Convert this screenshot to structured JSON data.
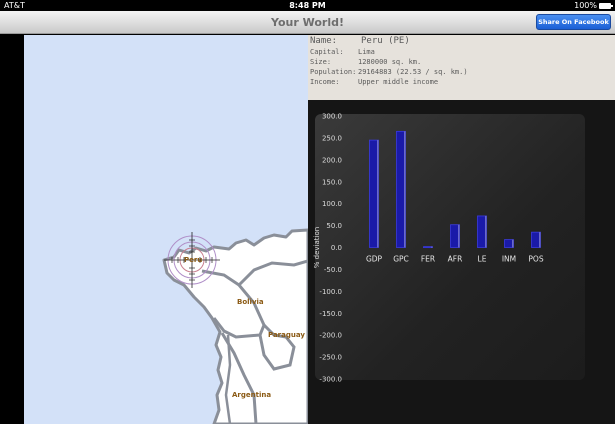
{
  "status_bar": {
    "carrier": "AT&T",
    "time": "8:48 PM",
    "battery": "100%"
  },
  "nav": {
    "title": "Your World!",
    "share_button": "Share On Facebook"
  },
  "map": {
    "labels": {
      "peru": "Peru",
      "bolivia": "Bolivia",
      "paraguay": "Paraguay",
      "argentina": "Argentina"
    }
  },
  "country": {
    "name_key": "Name:",
    "name": "Peru (PE)",
    "capital_key": "Capital:",
    "capital": "Lima",
    "size_key": "Size:",
    "size": "1280000 sq. km.",
    "population_key": "Population:",
    "population": "29164883 (22.53 / sq. km.)",
    "income_key": "Income:",
    "income": "Upper middle income"
  },
  "colors": {
    "bar_fill": "#1a1aa8",
    "bar_edge": "#3a3ae0",
    "border": "#8a8f99",
    "label": "#8b5a14"
  },
  "chart_data": {
    "type": "bar",
    "categories": [
      "GDP",
      "GPC",
      "FER",
      "AFR",
      "LE",
      "INM",
      "POS"
    ],
    "values": [
      245,
      265,
      2,
      52,
      72,
      18,
      35
    ],
    "ylabel": "% deviation",
    "ylim": [
      -300,
      300
    ],
    "yticks": [
      300,
      250,
      200,
      150,
      100,
      50,
      0,
      -50,
      -100,
      -150,
      -200,
      -250,
      -300
    ],
    "grid": false
  }
}
